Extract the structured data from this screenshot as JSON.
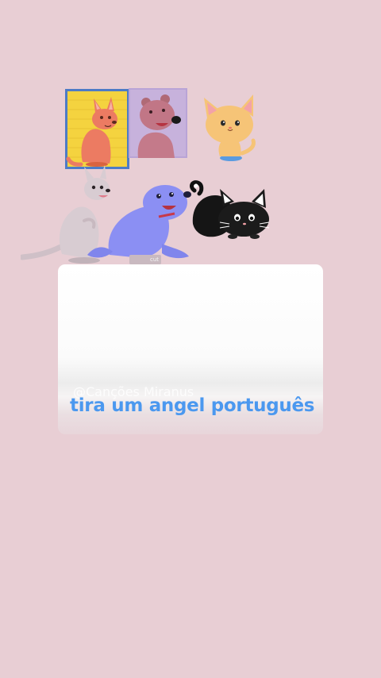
{
  "background_color": "#e8ced4",
  "caption": {
    "text": "tira um angel português",
    "color": "#4b98ef"
  },
  "watermark": {
    "text": "@Canções Miranus"
  },
  "badge": {
    "text": "cut"
  },
  "stickers": [
    {
      "name": "kangaroo-card-icon"
    },
    {
      "name": "bear-card-icon"
    },
    {
      "name": "cat-icon"
    },
    {
      "name": "kangaroo-icon"
    },
    {
      "name": "seal-icon"
    },
    {
      "name": "black-cat-icon"
    }
  ]
}
